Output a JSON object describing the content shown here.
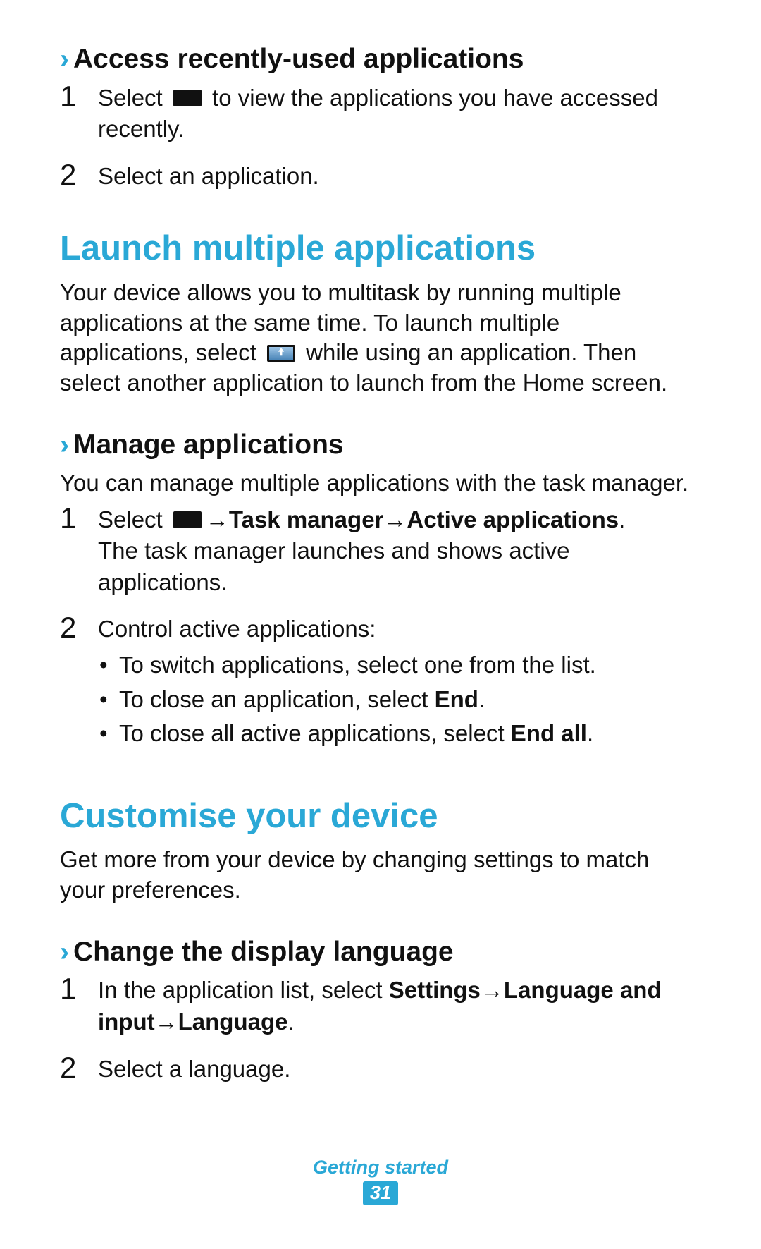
{
  "colors": {
    "accent": "#2aa8d6"
  },
  "footer": {
    "section": "Getting started",
    "page": "31"
  },
  "section1": {
    "title": "Access recently-used applications",
    "step1_a": "Select ",
    "step1_b": " to view the applications you have accessed recently.",
    "step2": "Select an application."
  },
  "section2": {
    "title": "Launch multiple applications",
    "para_a": "Your device allows you to multitask by running multiple applications at the same time. To launch multiple applications, select ",
    "para_b": " while using an application. Then select another application to launch from the Home screen."
  },
  "section3": {
    "title": "Manage applications",
    "intro": "You can manage multiple applications with the task manager.",
    "step1_a": "Select ",
    "step1_arrow1": " → ",
    "step1_b": "Task manager",
    "step1_arrow2": " → ",
    "step1_c": "Active applications",
    "step1_dot": ".",
    "step1_line2": "The task manager launches and shows active applications.",
    "step2_lead": "Control active applications:",
    "b1": "To switch applications, select one from the list.",
    "b2_a": "To close an application, select ",
    "b2_b": "End",
    "b2_c": ".",
    "b3_a": "To close all active applications, select ",
    "b3_b": "End all",
    "b3_c": "."
  },
  "section4": {
    "title": "Customise your device",
    "para": "Get more from your device by changing settings to match your preferences."
  },
  "section5": {
    "title": "Change the display language",
    "step1_a": "In the application list, select ",
    "step1_b": "Settings",
    "step1_arrow1": " → ",
    "step1_c": "Language and input",
    "step1_arrow2": " → ",
    "step1_d": "Language",
    "step1_dot": ".",
    "step2": "Select a language."
  }
}
